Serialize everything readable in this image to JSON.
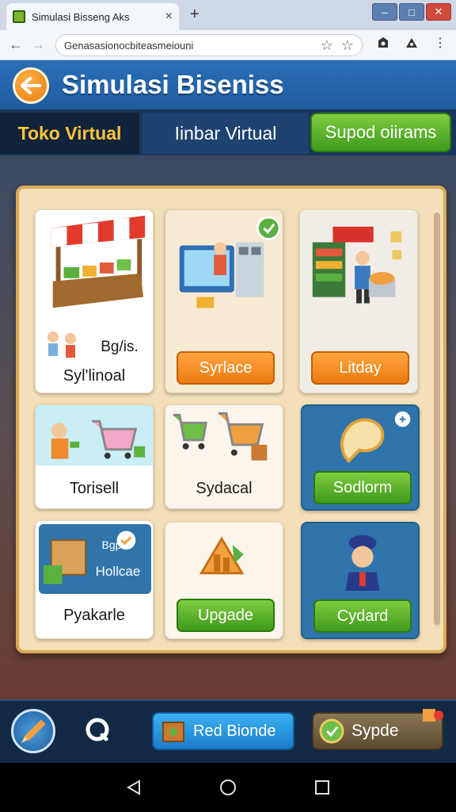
{
  "browser": {
    "tab_title": "Simulasi Bisseng Aks",
    "url": "Genasasionocbiteasmeiouni",
    "window_controls": [
      "–",
      "□",
      "✕"
    ]
  },
  "header": {
    "title": "Simulasi Biseniss"
  },
  "tabs": [
    {
      "label": "Toko Virtual"
    },
    {
      "label": "Iinbar Virtual"
    },
    {
      "label": "Supod oiirams"
    }
  ],
  "cards": {
    "c1": {
      "label_top": "Bg/is.",
      "label": "Syl'linoal"
    },
    "c2": {
      "button": "Syrlace"
    },
    "c3": {
      "button": "Litday"
    },
    "c4": {
      "label": "Torisell"
    },
    "c5": {
      "label": "Sydacal"
    },
    "c6": {
      "button": "Sodlorm"
    },
    "c7": {
      "tag_top": "Bgp",
      "tag_bottom": "Hollcae",
      "label": "Pyakarle"
    },
    "c8": {
      "button": "Upgade"
    },
    "c9": {
      "button": "Cydard"
    }
  },
  "bottom": {
    "btn1": "Red Bionde",
    "btn2": "Sypde"
  },
  "colors": {
    "accent_orange": "#ec7a10",
    "accent_green": "#3e9a1c",
    "header_blue": "#2a6fb7"
  }
}
